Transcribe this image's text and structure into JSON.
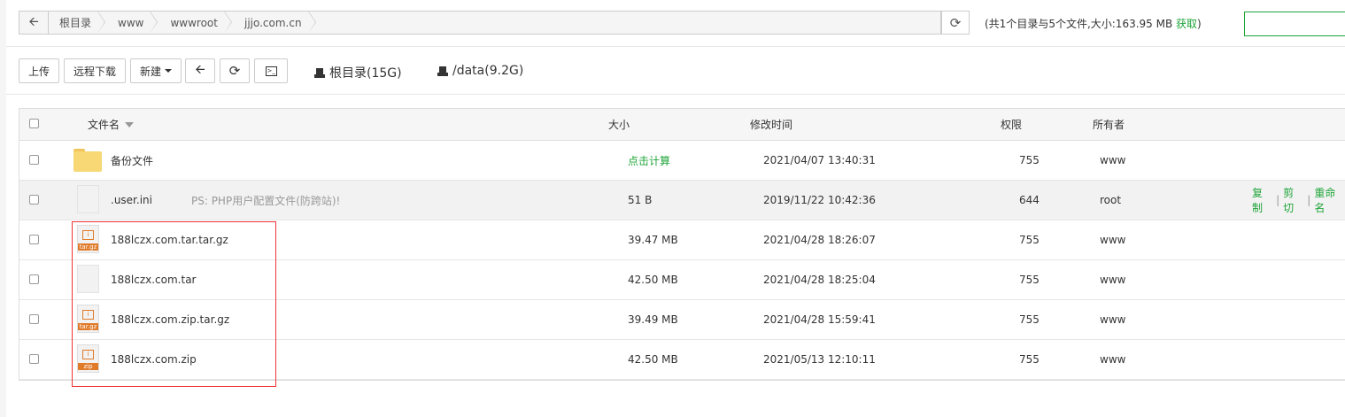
{
  "pathbar": {
    "back_icon": "arrow-left-icon",
    "crumbs": [
      "根目录",
      "www",
      "wwwroot",
      "jjjo.com.cn"
    ],
    "refresh_icon": "refresh-icon"
  },
  "summary": {
    "text": "(共1个目录与5个文件,大小:163.95 MB ",
    "get_label": "获取",
    "close_paren": ")"
  },
  "toolbar": {
    "upload": "上传",
    "remote_download": "远程下载",
    "new": "新建",
    "back_icon": "arrow-left-icon",
    "refresh_icon": "refresh-icon",
    "terminal_icon": "terminal-icon",
    "disks": [
      {
        "icon": "hdd-icon",
        "label": "根目录(15G)"
      },
      {
        "icon": "hdd-icon",
        "label": "/data(9.2G)"
      }
    ]
  },
  "table": {
    "headers": {
      "name": "文件名",
      "size": "大小",
      "mtime": "修改时间",
      "perm": "权限",
      "owner": "所有者"
    },
    "rows": [
      {
        "name": "备份文件",
        "icon": "folder-icon",
        "note": "",
        "size": "点击计算",
        "mtime": "2021/04/07 13:40:31",
        "perm": "755",
        "owner": "www"
      },
      {
        "name": ".user.ini",
        "icon": "file-icon",
        "note": "PS: PHP用户配置文件(防跨站)!",
        "size": "51 B",
        "mtime": "2019/11/22 10:42:36",
        "perm": "644",
        "owner": "root",
        "ops": [
          "复制",
          "剪切",
          "重命名"
        ]
      },
      {
        "name": "188lczx.com.tar.tar.gz",
        "icon": "archive-icon",
        "tag": "tar.gz",
        "note": "",
        "size": "39.47 MB",
        "mtime": "2021/04/28 18:26:07",
        "perm": "755",
        "owner": "www"
      },
      {
        "name": "188lczx.com.tar",
        "icon": "file-icon",
        "note": "",
        "size": "42.50 MB",
        "mtime": "2021/04/28 18:25:04",
        "perm": "755",
        "owner": "www"
      },
      {
        "name": "188lczx.com.zip.tar.gz",
        "icon": "archive-icon",
        "tag": "tar.gz",
        "note": "",
        "size": "39.49 MB",
        "mtime": "2021/04/28 15:59:41",
        "perm": "755",
        "owner": "www"
      },
      {
        "name": "188lczx.com.zip",
        "icon": "archive-icon",
        "tag": "zip",
        "note": "",
        "size": "42.50 MB",
        "mtime": "2021/05/13 12:10:11",
        "perm": "755",
        "owner": "www"
      }
    ]
  },
  "colors": {
    "accent": "#20a53a",
    "highlight_box": "#ee3333",
    "archive_orange": "#e07b2a"
  }
}
